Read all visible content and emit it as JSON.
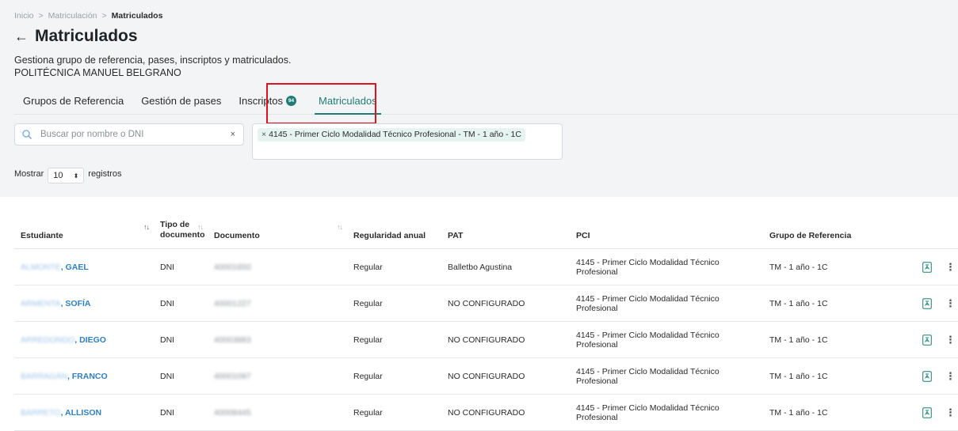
{
  "breadcrumb": {
    "items": [
      "Inicio",
      "Matriculación"
    ],
    "separator": ">",
    "current": "Matriculados"
  },
  "page": {
    "title": "Matriculados",
    "description": "Gestiona grupo de referencia, pases, inscriptos y matriculados.",
    "institution": "POLITÉCNICA MANUEL BELGRANO"
  },
  "tabs": [
    {
      "label": "Grupos de Referencia"
    },
    {
      "label": "Gestión de pases"
    },
    {
      "label": "Inscriptos",
      "badge": "94"
    },
    {
      "label": "Matriculados",
      "active": true
    }
  ],
  "search": {
    "placeholder": "Buscar por nombre o DNI",
    "value": "",
    "clear_symbol": "×"
  },
  "filter": {
    "chip_remove": "×",
    "chip_label": "4145 - Primer Ciclo Modalidad Técnico Profesional - TM - 1 año - 1C"
  },
  "pagination": {
    "prefix": "Mostrar",
    "page_size": "10",
    "suffix": "registros"
  },
  "table": {
    "headers": {
      "student": "Estudiante",
      "doc_type_1": "Tipo de",
      "doc_type_2": "documento",
      "document": "Documento",
      "regularity": "Regularidad anual",
      "pat": "PAT",
      "pci": "PCI",
      "group": "Grupo de Referencia"
    },
    "rows": [
      {
        "surname": "ALMONTE",
        "name": ", GAEL",
        "doc_type": "DNI",
        "document": "40001650",
        "regularity": "Regular",
        "pat": "Balletbo Agustina",
        "pci": "4145 - Primer Ciclo Modalidad Técnico Profesional",
        "group": "TM - 1 año - 1C"
      },
      {
        "surname": "ARMENTA",
        "name": ", SOFÍA",
        "doc_type": "DNI",
        "document": "40001227",
        "regularity": "Regular",
        "pat": "NO CONFIGURADO",
        "pci": "4145 - Primer Ciclo Modalidad Técnico Profesional",
        "group": "TM - 1 año - 1C"
      },
      {
        "surname": "ARREDONDO",
        "name": ", DIEGO",
        "doc_type": "DNI",
        "document": "40003883",
        "regularity": "Regular",
        "pat": "NO CONFIGURADO",
        "pci": "4145 - Primer Ciclo Modalidad Técnico Profesional",
        "group": "TM - 1 año - 1C"
      },
      {
        "surname": "BARRAGÁN",
        "name": ", FRANCO",
        "doc_type": "DNI",
        "document": "40001097",
        "regularity": "Regular",
        "pat": "NO CONFIGURADO",
        "pci": "4145 - Primer Ciclo Modalidad Técnico Profesional",
        "group": "TM - 1 año - 1C"
      },
      {
        "surname": "BARRETO",
        "name": ", ALLISON",
        "doc_type": "DNI",
        "document": "40008445",
        "regularity": "Regular",
        "pat": "NO CONFIGURADO",
        "pci": "4145 - Primer Ciclo Modalidad Técnico Profesional",
        "group": "TM - 1 año - 1C"
      }
    ],
    "row_actions": {
      "icon": "pdf-document-icon",
      "menu": "⋮"
    }
  },
  "colors": {
    "accent": "#1f7d74",
    "link": "#2f7fc1",
    "highlight": "#e0121f",
    "header_bg": "#f3f4f5"
  }
}
